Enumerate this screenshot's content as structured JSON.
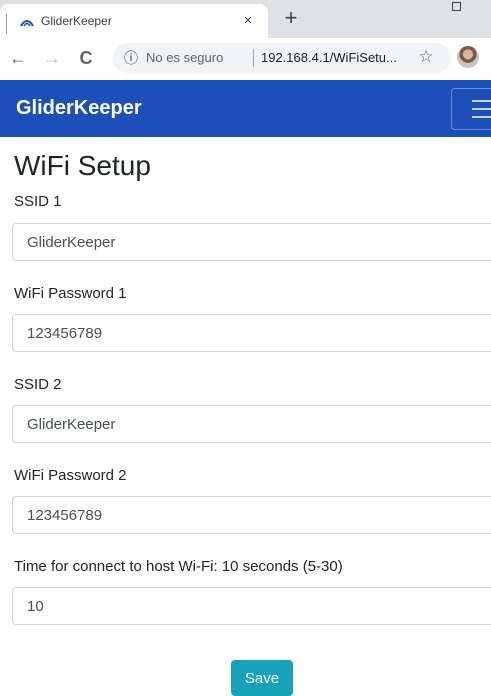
{
  "browser": {
    "tab_title": "GliderKeeper",
    "tab_close_icon": "×",
    "new_tab_icon": "+",
    "back_icon": "←",
    "forward_icon": "→",
    "reload_icon": "C",
    "info_icon": "ⓘ",
    "security_text": "No es seguro",
    "url": "192.168.4.1/WiFiSetu...",
    "bookmark_icon": "☆"
  },
  "navbar": {
    "brand": "GliderKeeper",
    "brand_color": "#1d4fb8"
  },
  "page": {
    "title": "WiFi Setup"
  },
  "form": {
    "ssid1_label": "SSID 1",
    "ssid1_value": "GliderKeeper",
    "password1_label": "WiFi Password 1",
    "password1_value": "123456789",
    "ssid2_label": "SSID 2",
    "ssid2_value": "GliderKeeper",
    "password2_label": "WiFi Password 2",
    "password2_value": "123456789",
    "timeout_label": "Time for connect to host Wi-Fi: 10 seconds (5-30)",
    "timeout_value": "10",
    "save_label": "Save",
    "save_color": "#17a2b8"
  }
}
